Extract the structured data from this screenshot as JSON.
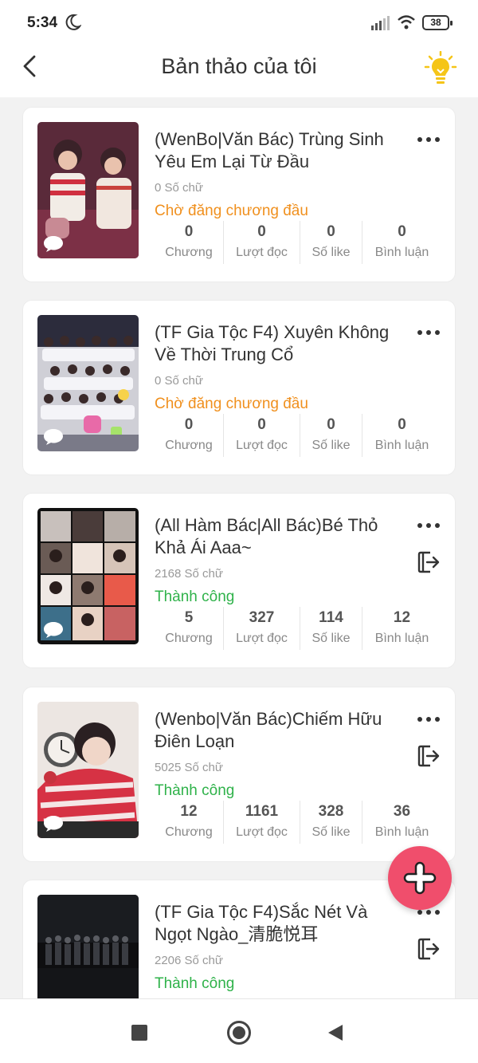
{
  "status_bar": {
    "time": "5:34",
    "battery": "38"
  },
  "header": {
    "title": "Bản thảo của tôi"
  },
  "stat_labels": {
    "chapters": "Chương",
    "reads": "Lượt đọc",
    "likes": "Số like",
    "comments": "Bình luận"
  },
  "books": [
    {
      "title": "(WenBo|Văn Bác) Trùng Sinh Yêu Em Lại Từ Đầu",
      "words": "0 Số chữ",
      "status": "Chờ đăng chương đầu",
      "chapters": "0",
      "reads": "0",
      "likes": "0",
      "comments": "0"
    },
    {
      "title": "(TF Gia Tộc F4) Xuyên Không Về Thời Trung Cổ",
      "words": "0 Số chữ",
      "status": "Chờ đăng chương đầu",
      "chapters": "0",
      "reads": "0",
      "likes": "0",
      "comments": "0"
    },
    {
      "title": "(All Hàm Bác|All Bác)Bé Thỏ Khả Ái Aaa~",
      "words": "2168 Số chữ",
      "status": "Thành công",
      "chapters": "5",
      "reads": "327",
      "likes": "114",
      "comments": "12"
    },
    {
      "title": "(Wenbo|Văn Bác)Chiếm Hữu Điên Loạn",
      "words": "5025 Số chữ",
      "status": "Thành công",
      "chapters": "12",
      "reads": "1161",
      "likes": "328",
      "comments": "36"
    },
    {
      "title": "(TF Gia Tộc F4)Sắc Nét Và Ngọt Ngào_清脆悦耳",
      "words": "2206 Số chữ",
      "status": "Thành công"
    }
  ],
  "colors": {
    "pending": "#f0901e",
    "success": "#2fb24a",
    "fab": "#f04e6c",
    "bulb": "#f5c518"
  }
}
